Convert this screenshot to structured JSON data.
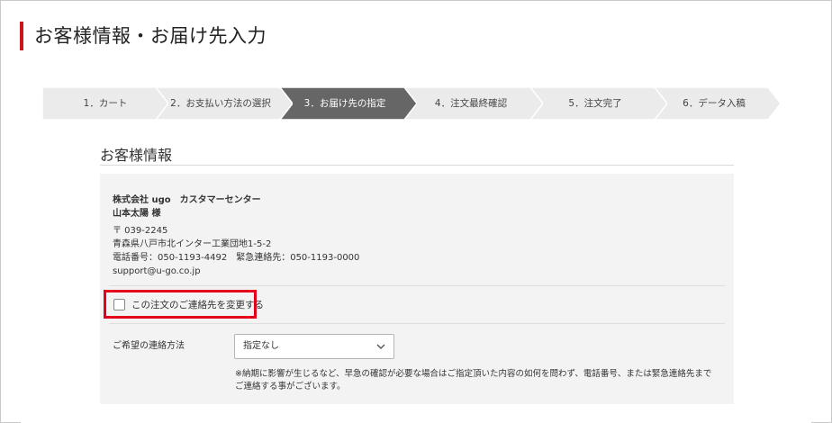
{
  "page": {
    "title": "お客様情報・お届け先入力",
    "accent_color": "#c9161d"
  },
  "steps": [
    {
      "label": "1．カート",
      "active": false
    },
    {
      "label": "2．お支払い方法の選択",
      "active": false
    },
    {
      "label": "3．お届け先の指定",
      "active": true
    },
    {
      "label": "4．注文最終確認",
      "active": false
    },
    {
      "label": "5．注文完了",
      "active": false
    },
    {
      "label": "6．データ入稿",
      "active": false
    }
  ],
  "step_colors": {
    "active": "#666666",
    "inactive": "#ebebeb"
  },
  "customer": {
    "section_title": "お客様情報",
    "company": "株式会社 ugo　カスタマーセンター",
    "name": "山本太陽 様",
    "postal": "〒 039-2245",
    "address": "青森県八戸市北インター工業団地1-5-2",
    "phones": "電話番号：050-1193-4492　緊急連絡先：050-1193-0000",
    "email": "support@u-go.co.jp"
  },
  "change_contact": {
    "label": "この注文のご連絡先を変更する",
    "checked": false,
    "highlight_color": "#e4001b"
  },
  "contact_method": {
    "label": "ご希望の連絡方法",
    "selected": "指定なし",
    "note_line1": "※納期に影響が生じるなど、早急の確認が必要な場合はご指定頂いた内容の如何を問わず、電話番号、または緊急連絡先まで",
    "note_line2": "ご連絡する事がございます。"
  }
}
